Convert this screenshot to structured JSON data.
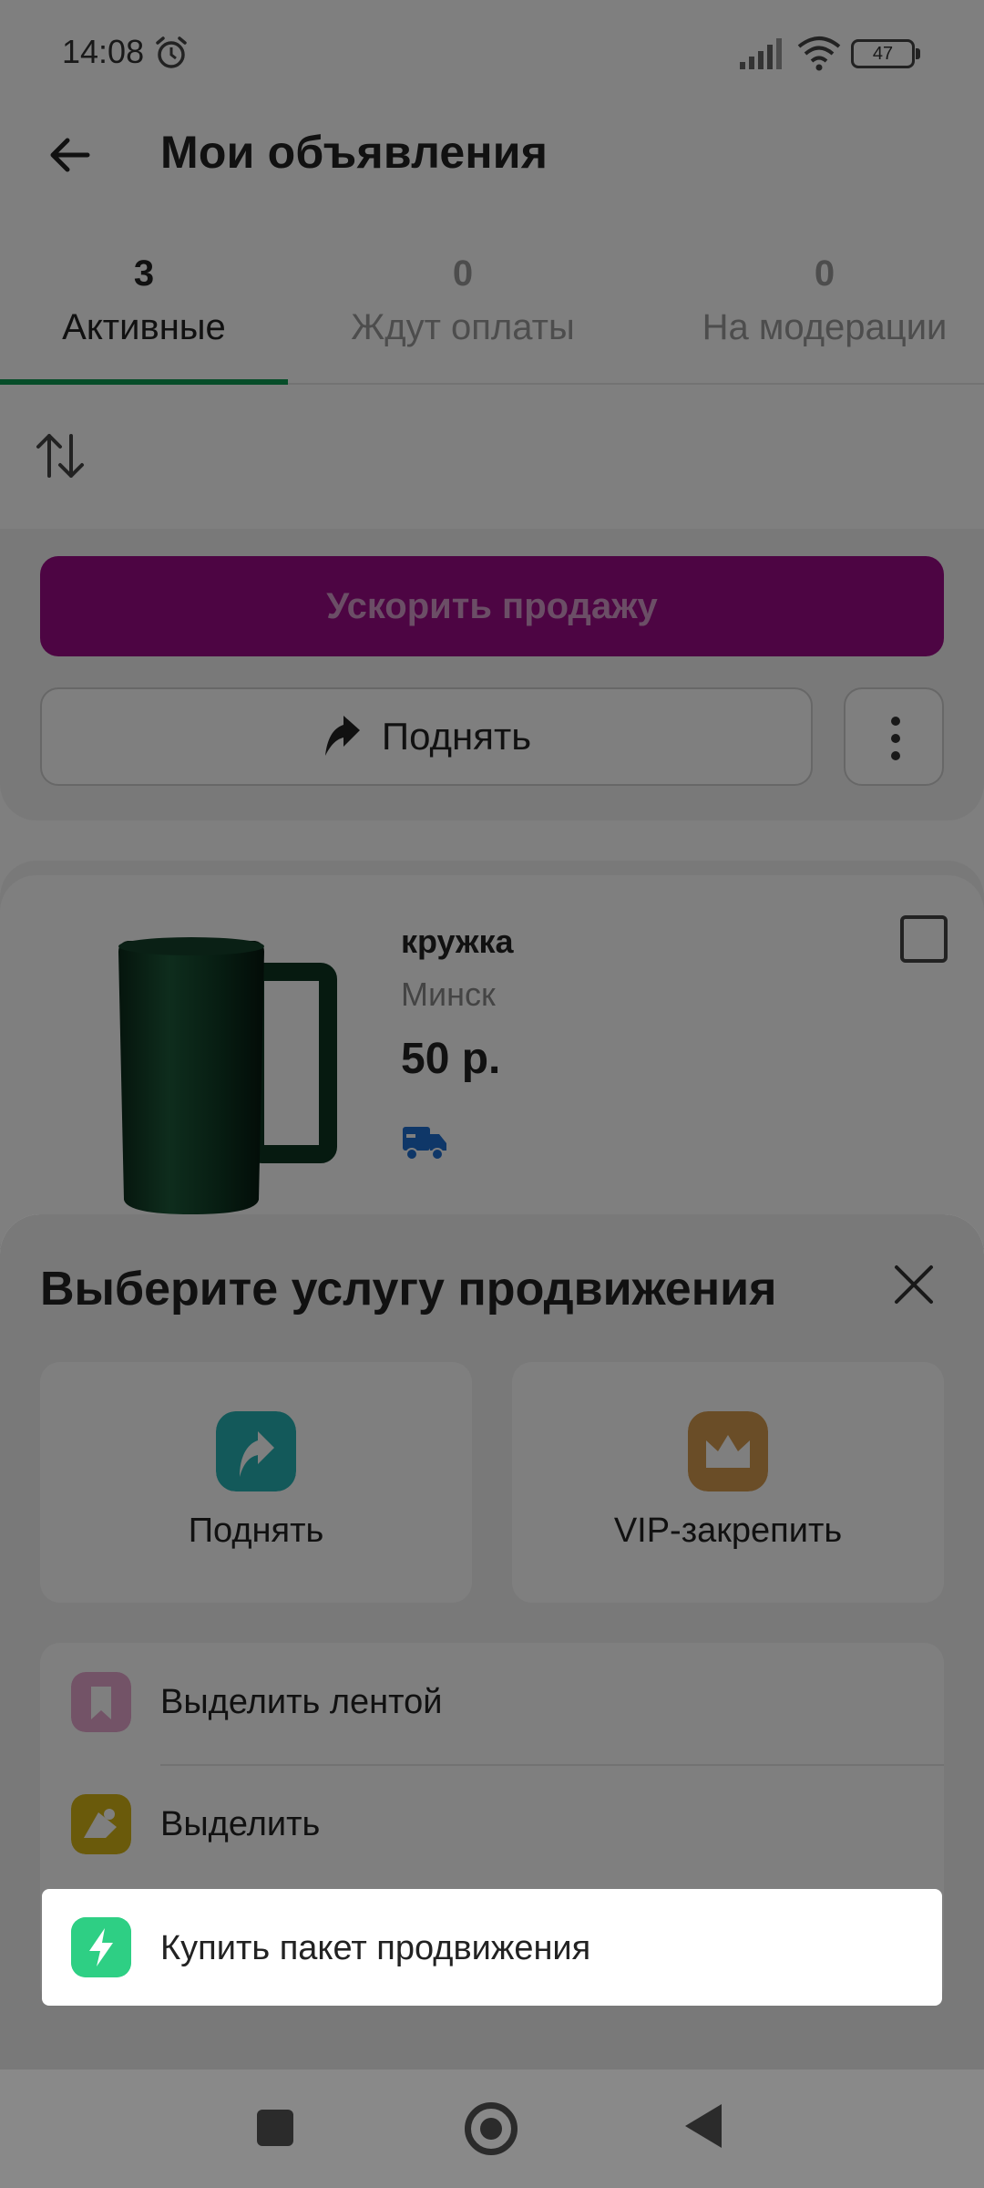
{
  "status_bar": {
    "time": "14:08",
    "battery": "47",
    "icons": [
      "alarm-icon",
      "signal-icon",
      "wifi-icon",
      "battery-icon"
    ]
  },
  "app_bar": {
    "title": "Мои объявления",
    "back_icon": "arrow-left-icon"
  },
  "tabs": [
    {
      "count": "3",
      "label": "Активные",
      "active": true
    },
    {
      "count": "0",
      "label": "Ждут оплаты",
      "active": false
    },
    {
      "count": "0",
      "label": "На модерации",
      "active": false
    }
  ],
  "toolbar": {
    "sort_icon": "sort-arrows-icon",
    "accelerate_label": "Ускорить продажу",
    "raise_label": "Поднять",
    "more_icon": "more-vertical-icon"
  },
  "listing": {
    "title": "кружка",
    "city": "Минск",
    "price": "50 р.",
    "delivery_icon": "truck-icon",
    "image": "green-mug"
  },
  "sheet": {
    "title": "Выберите услугу продвижения",
    "close_icon": "close-icon",
    "tiles": [
      {
        "label": "Поднять",
        "icon": "raise-arrow-icon",
        "color": "#27b3b4"
      },
      {
        "label": "VIP-закрепить",
        "icon": "crown-icon",
        "color": "#d49a4e"
      }
    ],
    "items": [
      {
        "label": "Выделить лентой",
        "icon": "bookmark-icon",
        "color": "#e7a6cf"
      },
      {
        "label": "Выделить",
        "icon": "highlight-shape-icon",
        "color": "#d4b416"
      },
      {
        "label": "Купить пакет продвижения",
        "icon": "lightning-icon",
        "color": "#2ecf84"
      }
    ]
  },
  "colors": {
    "brand_green": "#0f9b52",
    "accelerate_purple": "#9b0a86",
    "delivery_blue": "#1e6fd1"
  },
  "nav_bar": [
    "recents-button",
    "home-button",
    "back-button"
  ]
}
